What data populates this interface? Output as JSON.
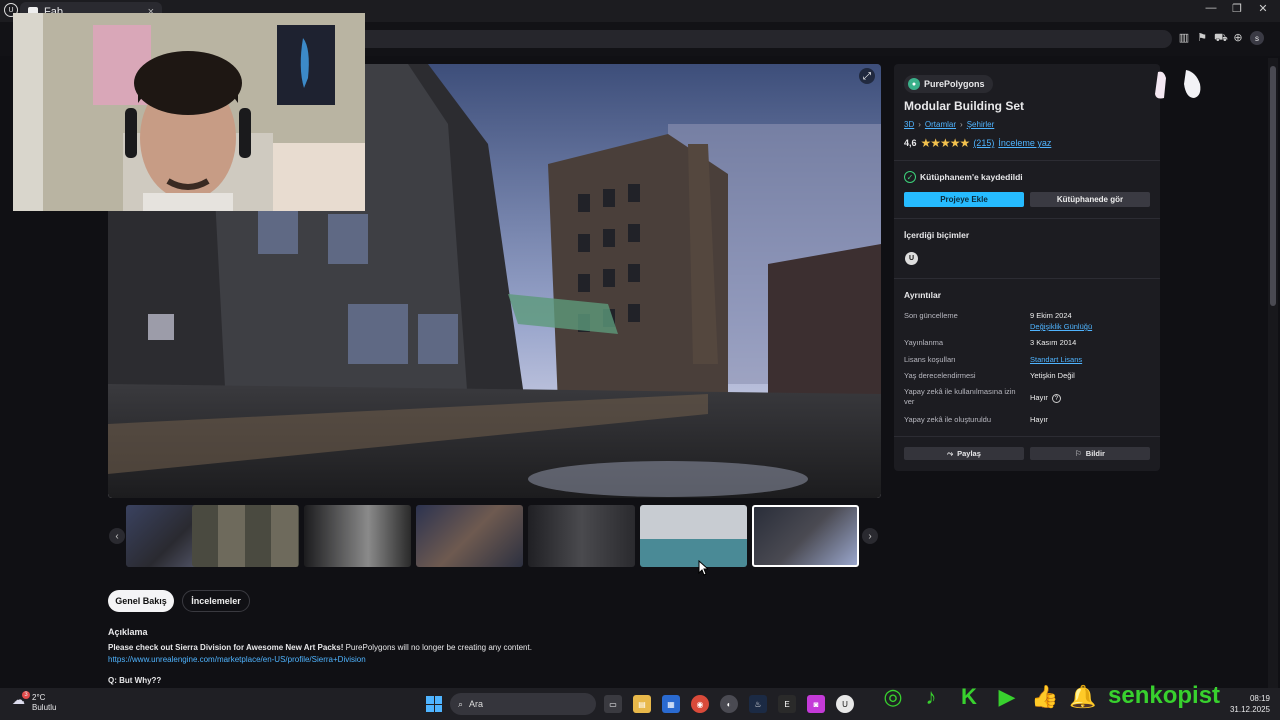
{
  "browser": {
    "tab_title": "Fab",
    "tab_close": "×",
    "window_controls": [
      "—",
      "❐",
      "✕"
    ],
    "profile_initial": "s"
  },
  "hero": {
    "expand_icon": "⤢"
  },
  "thumbnails": {
    "count": 7,
    "selected_index": 6,
    "prev": "‹",
    "next": "›"
  },
  "tabs": {
    "overview": "Genel Bakış",
    "reviews": "İncelemeler"
  },
  "description": {
    "heading": "Açıklama",
    "bold_text": "Please check out Sierra Division for Awesome New Art Packs!",
    "text": " PurePolygons will no longer be creating any content.",
    "link": "https://www.unrealengine.com/marketplace/en-US/profile/Sierra+Division",
    "question": "Q: But Why??"
  },
  "product": {
    "seller": "PurePolygons",
    "title": "Modular Building Set",
    "breadcrumbs": [
      "3D",
      "Ortamlar",
      "Şehirler"
    ],
    "rating": "4,6",
    "stars": "★★★★★",
    "review_count": "(215)",
    "write_review": "İnceleme yaz",
    "saved_text": "Kütüphanem'e kaydedildi",
    "add_to_project": "Projeye Ekle",
    "view_in_library": "Kütüphanede gör",
    "formats_title": "İçerdiği biçimler",
    "format_icon_label": "U",
    "details_title": "Ayrıntılar",
    "details": [
      {
        "label": "Son güncelleme",
        "value": "9 Ekim 2024",
        "sub": "Değişiklik Günlüğü"
      },
      {
        "label": "Yayınlanma",
        "value": "3 Kasım 2014"
      },
      {
        "label": "Lisans koşulları",
        "value": "Standart Lisans"
      },
      {
        "label": "Yaş derecelendirmesi",
        "value": "Yetişkin Değil"
      },
      {
        "label": "Yapay zekâ ile kullanılmasına izin ver",
        "value": "Hayır"
      },
      {
        "label": "Yapay zekâ ile oluşturuldu",
        "value": "Hayır"
      }
    ],
    "share": "Paylaş",
    "report": "Bildir"
  },
  "taskbar": {
    "temp": "2°C",
    "condition": "Bulutlu",
    "search_placeholder": "Ara",
    "time": "08:19",
    "date": "31.12.2025",
    "weather_badge": "3"
  },
  "overlay": {
    "brand": "senkopist"
  },
  "colors": {
    "accent": "#26bbff",
    "link": "#4fb4ff",
    "brand_green": "#38d12e",
    "star": "#f2c14e"
  }
}
